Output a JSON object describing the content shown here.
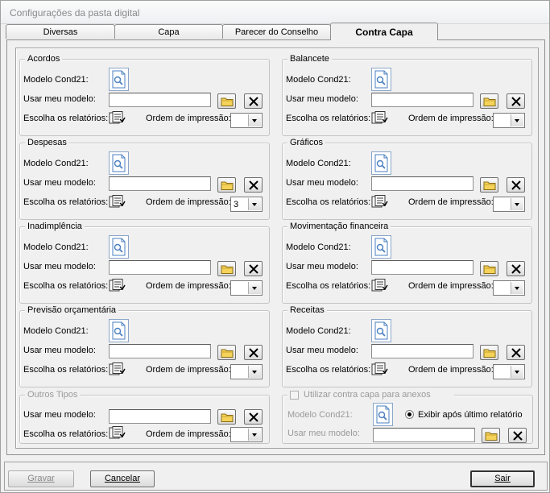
{
  "window": {
    "title": "Configurações da pasta digital"
  },
  "tabs": [
    {
      "label": "Diversas"
    },
    {
      "label": "Capa"
    },
    {
      "label": "Parecer do Conselho"
    },
    {
      "label": "Contra Capa",
      "active": true
    }
  ],
  "labels": {
    "modelo": "Modelo Cond21:",
    "usar": "Usar meu modelo:",
    "escolha": "Escolha os relatórios:",
    "ordem": "Ordem de impressão:"
  },
  "groups": {
    "acordos": {
      "title": "Acordos",
      "ordem": ""
    },
    "balancete": {
      "title": "Balancete",
      "ordem": ""
    },
    "despesas": {
      "title": "Despesas",
      "ordem": "3"
    },
    "graficos": {
      "title": "Gráficos",
      "ordem": ""
    },
    "inadimplencia": {
      "title": "Inadimplência",
      "ordem": ""
    },
    "movimentacao": {
      "title": "Movimentação financeira",
      "ordem": ""
    },
    "previsao": {
      "title": "Previsão orçamentária",
      "ordem": ""
    },
    "receitas": {
      "title": "Receitas",
      "ordem": ""
    },
    "outros": {
      "title": "Outros Tipos",
      "ordem": ""
    }
  },
  "anexos": {
    "checkbox_label": "Utilizar contra capa para anexos",
    "radio_label": "Exibir após último relatório"
  },
  "footer": {
    "gravar": "Gravar",
    "cancelar": "Cancelar",
    "sair": "Sair"
  },
  "colors": {
    "icon_blue": "#4a7fc0",
    "folder_yellow": "#f5d35a"
  }
}
